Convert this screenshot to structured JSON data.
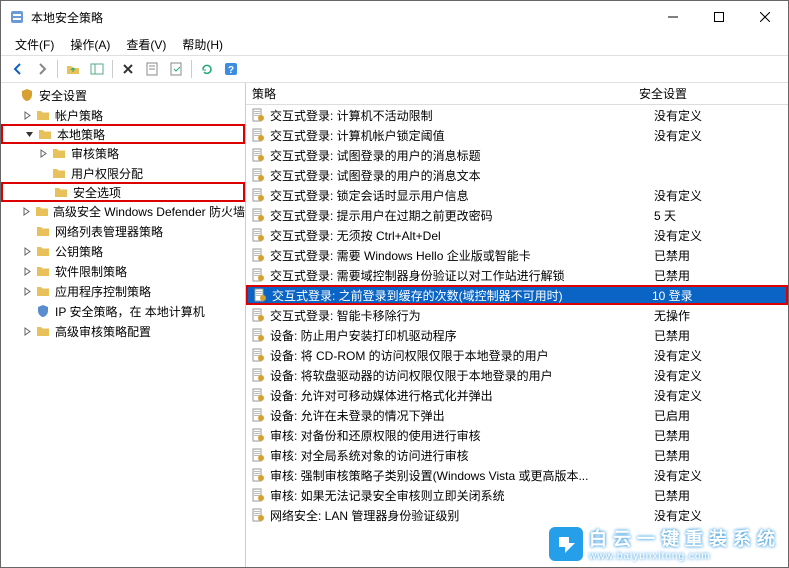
{
  "window": {
    "title": "本地安全策略"
  },
  "menu": {
    "file": "文件(F)",
    "action": "操作(A)",
    "view": "查看(V)",
    "help": "帮助(H)"
  },
  "tree": {
    "root": "安全设置",
    "items": [
      {
        "label": "帐户策略",
        "indent": 1,
        "exp": ">"
      },
      {
        "label": "本地策略",
        "indent": 1,
        "exp": "v",
        "hl": true
      },
      {
        "label": "审核策略",
        "indent": 2,
        "exp": ">"
      },
      {
        "label": "用户权限分配",
        "indent": 2,
        "exp": ""
      },
      {
        "label": "安全选项",
        "indent": 2,
        "exp": "",
        "hl": true
      },
      {
        "label": "高级安全 Windows Defender 防火墙",
        "indent": 1,
        "exp": ">"
      },
      {
        "label": "网络列表管理器策略",
        "indent": 1,
        "exp": ""
      },
      {
        "label": "公钥策略",
        "indent": 1,
        "exp": ">"
      },
      {
        "label": "软件限制策略",
        "indent": 1,
        "exp": ">"
      },
      {
        "label": "应用程序控制策略",
        "indent": 1,
        "exp": ">"
      },
      {
        "label": "IP 安全策略，在 本地计算机",
        "indent": 1,
        "exp": ""
      },
      {
        "label": "高级审核策略配置",
        "indent": 1,
        "exp": ">"
      }
    ]
  },
  "list": {
    "col_policy": "策略",
    "col_setting": "安全设置",
    "rows": [
      {
        "policy": "交互式登录: 计算机不活动限制",
        "setting": "没有定义"
      },
      {
        "policy": "交互式登录: 计算机帐户锁定阈值",
        "setting": "没有定义"
      },
      {
        "policy": "交互式登录: 试图登录的用户的消息标题",
        "setting": ""
      },
      {
        "policy": "交互式登录: 试图登录的用户的消息文本",
        "setting": ""
      },
      {
        "policy": "交互式登录: 锁定会话时显示用户信息",
        "setting": "没有定义"
      },
      {
        "policy": "交互式登录: 提示用户在过期之前更改密码",
        "setting": "5 天"
      },
      {
        "policy": "交互式登录: 无须按 Ctrl+Alt+Del",
        "setting": "没有定义"
      },
      {
        "policy": "交互式登录: 需要 Windows Hello 企业版或智能卡",
        "setting": "已禁用"
      },
      {
        "policy": "交互式登录: 需要域控制器身份验证以对工作站进行解锁",
        "setting": "已禁用"
      },
      {
        "policy": "交互式登录: 之前登录到缓存的次数(域控制器不可用时)",
        "setting": "10 登录",
        "selected": true
      },
      {
        "policy": "交互式登录: 智能卡移除行为",
        "setting": "无操作"
      },
      {
        "policy": "设备: 防止用户安装打印机驱动程序",
        "setting": "已禁用"
      },
      {
        "policy": "设备: 将 CD-ROM 的访问权限仅限于本地登录的用户",
        "setting": "没有定义"
      },
      {
        "policy": "设备: 将软盘驱动器的访问权限仅限于本地登录的用户",
        "setting": "没有定义"
      },
      {
        "policy": "设备: 允许对可移动媒体进行格式化并弹出",
        "setting": "没有定义"
      },
      {
        "policy": "设备: 允许在未登录的情况下弹出",
        "setting": "已启用"
      },
      {
        "policy": "审核: 对备份和还原权限的使用进行审核",
        "setting": "已禁用"
      },
      {
        "policy": "审核: 对全局系统对象的访问进行审核",
        "setting": "已禁用"
      },
      {
        "policy": "审核: 强制审核策略子类别设置(Windows Vista 或更高版本...",
        "setting": "没有定义"
      },
      {
        "policy": "审核: 如果无法记录安全审核则立即关闭系统",
        "setting": "已禁用"
      },
      {
        "policy": "网络安全: LAN 管理器身份验证级别",
        "setting": "没有定义"
      }
    ]
  },
  "watermark": {
    "cn": "白云一键重装系统",
    "en": "www.baiyunxitong.com"
  }
}
